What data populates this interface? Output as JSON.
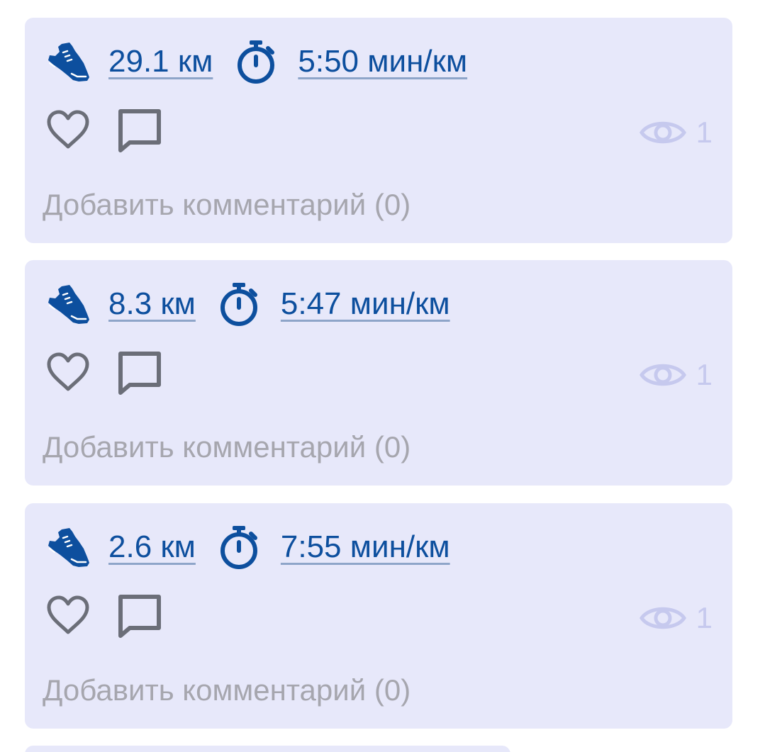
{
  "colors": {
    "card_background": "#e7e8fa",
    "link": "#0d4f9e",
    "action_icon": "#6b6e78",
    "views": "#c6c9ee",
    "placeholder": "#a6a6ae"
  },
  "icons": {
    "activity": "running-shoe-icon",
    "pace": "stopwatch-icon",
    "like": "heart-icon",
    "comment": "comment-icon",
    "views": "eye-icon"
  },
  "workouts": [
    {
      "distance": "29.1 км",
      "pace": "5:50 мин/км",
      "views": "1",
      "add_comment_label": "Добавить комментарий (0)"
    },
    {
      "distance": "8.3 км",
      "pace": "5:47 мин/км",
      "views": "1",
      "add_comment_label": "Добавить комментарий (0)"
    },
    {
      "distance": "2.6 км",
      "pace": "7:55 мин/км",
      "views": "1",
      "add_comment_label": "Добавить комментарий (0)"
    }
  ]
}
